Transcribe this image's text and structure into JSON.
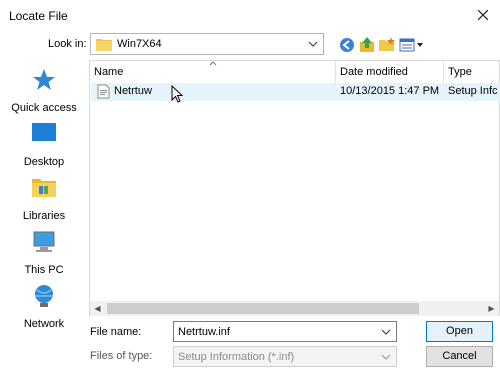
{
  "window": {
    "title": "Locate File"
  },
  "look_in": {
    "label": "Look in:",
    "value": "Win7X64"
  },
  "toolbar": {
    "icons": [
      "back-icon",
      "up-folder-icon",
      "new-folder-icon",
      "view-menu-icon"
    ]
  },
  "places": [
    {
      "label": "Quick access",
      "icon": "star-icon"
    },
    {
      "label": "Desktop",
      "icon": "desktop-icon"
    },
    {
      "label": "Libraries",
      "icon": "libraries-icon"
    },
    {
      "label": "This PC",
      "icon": "computer-icon"
    },
    {
      "label": "Network",
      "icon": "network-icon"
    }
  ],
  "filelist": {
    "columns": [
      "Name",
      "Date modified",
      "Type"
    ],
    "rows": [
      {
        "name": "Netrtuw",
        "date_modified": "10/13/2015 1:47 PM",
        "type": "Setup Infc"
      }
    ]
  },
  "file_name": {
    "label": "File name:",
    "value": "Netrtuw.inf"
  },
  "files_of_type": {
    "label": "Files of type:",
    "value": "Setup Information (*.inf)"
  },
  "buttons": {
    "open": "Open",
    "cancel": "Cancel"
  },
  "colors": {
    "accent": "#0078d7",
    "selection": "#e5f3fb"
  }
}
